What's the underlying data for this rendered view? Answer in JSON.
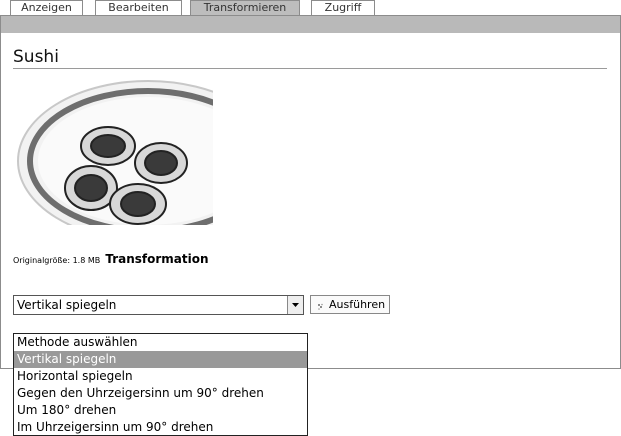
{
  "tabs": [
    {
      "label": "Anzeigen"
    },
    {
      "label": "Bearbeiten"
    },
    {
      "label": "Transformieren"
    },
    {
      "label": "Zugriff"
    }
  ],
  "page": {
    "title": "Sushi",
    "original_size_label": "Originalgröße: 1.8 MB",
    "transformation_heading": "Transformation"
  },
  "form": {
    "selected": "Vertikal spiegeln",
    "execute_label": "Ausführen",
    "options": [
      "Methode auswählen",
      "Vertikal spiegeln",
      "Horizontal spiegeln",
      "Gegen den Uhrzeigersinn um 90° drehen",
      "Um 180° drehen",
      "Im Uhrzeigersinn um 90° drehen"
    ]
  },
  "colors": {
    "tab_active": "#bdbdbd",
    "panel_bar": "#b9b9b9",
    "option_highlight": "#999999"
  }
}
